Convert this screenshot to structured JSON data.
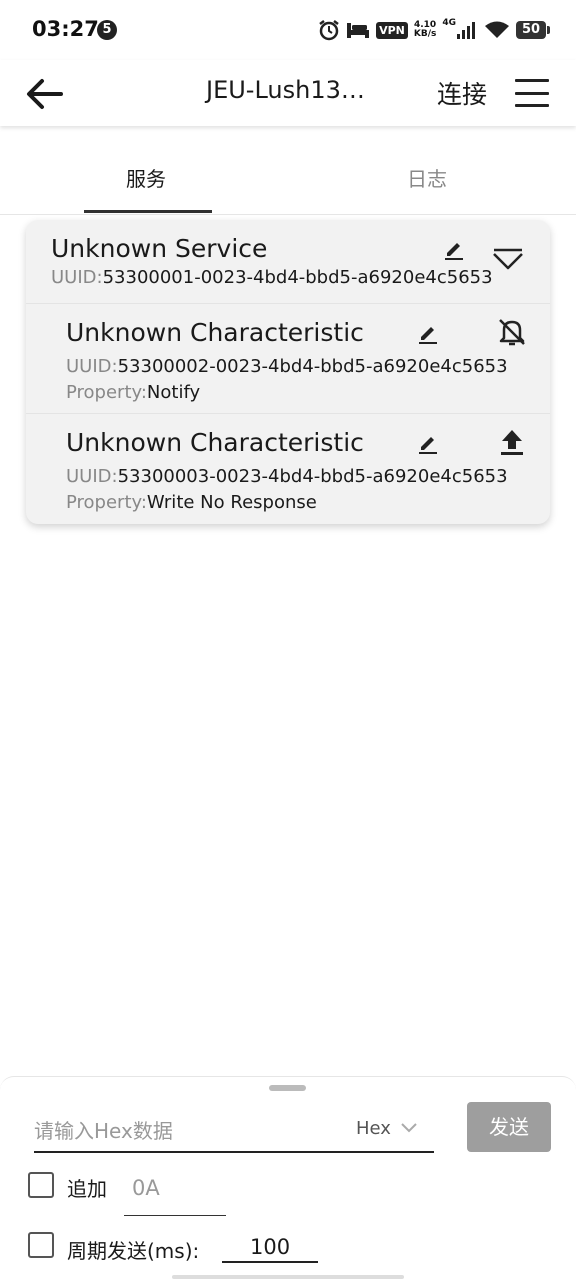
{
  "status_bar": {
    "time": "03:27",
    "notification_count": "5",
    "vpn": "VPN",
    "speed_value": "4.10",
    "speed_unit": "KB/s",
    "network": "4G",
    "battery": "50"
  },
  "app_bar": {
    "title": "JEU-Lush13…",
    "connect_label": "连接",
    "icons": [
      "arrow-left-icon",
      "hamburger-menu-icon"
    ]
  },
  "tabs": [
    {
      "label": "服务",
      "active": true
    },
    {
      "label": "日志",
      "active": false
    }
  ],
  "service": {
    "name": "Unknown Service",
    "uuid_label": "UUID:",
    "uuid": "53300001-0023-4bd4-bbd5-a6920e4c5653",
    "expanded": true,
    "characteristics": [
      {
        "name": "Unknown Characteristic",
        "uuid_label": "UUID:",
        "uuid": "53300002-0023-4bd4-bbd5-a6920e4c5653",
        "property_label": "Property:",
        "property": "Notify",
        "action_icon": "bell-off-icon"
      },
      {
        "name": "Unknown Characteristic",
        "uuid_label": "UUID:",
        "uuid": "53300003-0023-4bd4-bbd5-a6920e4c5653",
        "property_label": "Property:",
        "property": "Write No Response",
        "action_icon": "upload-icon"
      }
    ]
  },
  "send_panel": {
    "input_placeholder": "请输入Hex数据",
    "format": "Hex",
    "send_label": "发送",
    "append_label": "追加",
    "append_value": "0A",
    "append_checked": false,
    "period_label": "周期发送(ms):",
    "period_value": "100",
    "period_checked": false
  }
}
